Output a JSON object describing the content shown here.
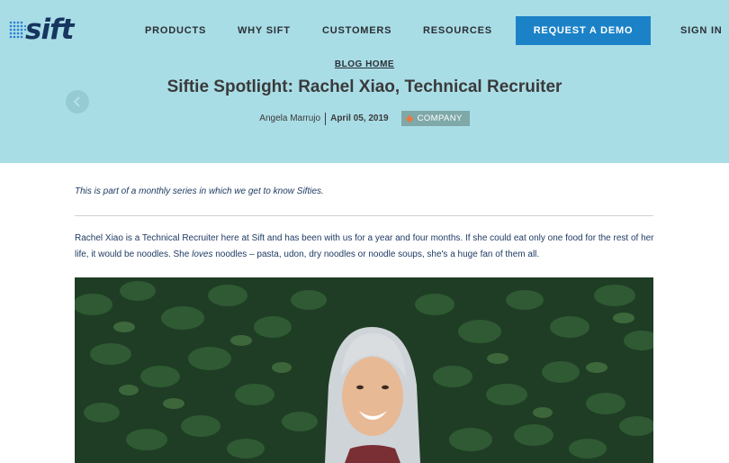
{
  "header": {
    "logo_text": "sift",
    "nav": {
      "products": "PRODUCTS",
      "why_sift": "WHY SIFT",
      "customers": "CUSTOMERS",
      "resources": "RESOURCES",
      "request_demo": "REQUEST A DEMO",
      "sign_in": "SIGN IN"
    }
  },
  "hero": {
    "blog_home": "BLOG HOME",
    "title": "Siftie Spotlight: Rachel Xiao, Technical Recruiter",
    "author": "Angela Marrujo",
    "date": "April 05, 2019",
    "tag": "COMPANY"
  },
  "article": {
    "intro": "This is part of a monthly series in which we get to know Sifties.",
    "para_part1": "Rachel Xiao is a Technical Recruiter here at Sift and has been with us for a year and four months. If she could eat only one food for the rest of her life, it would be noodles. She ",
    "para_emphasis": "loves",
    "para_part2": " noodles – pasta, udon, dry noodles or noodle soups, she's a huge fan of them all."
  },
  "colors": {
    "hero_bg": "#a9dde6",
    "brand_navy": "#16355f",
    "demo_button": "#1b82c8",
    "tag_bg": "#7fa8a8",
    "tag_accent": "#e9793e"
  },
  "icons": {
    "logo_mark": "dot-grid-icon",
    "prev": "chevron-left-icon",
    "tag": "diamond-icon"
  }
}
